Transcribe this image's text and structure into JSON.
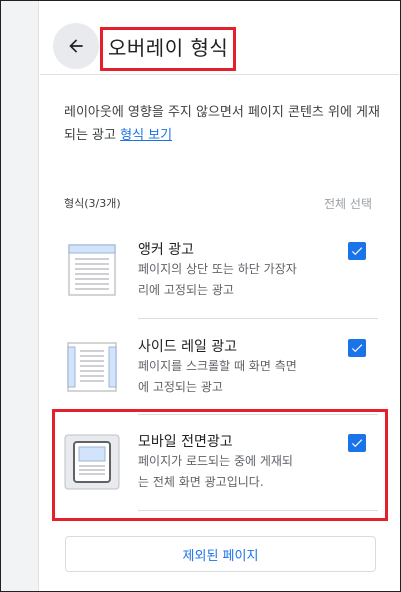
{
  "header": {
    "title": "오버레이 형식",
    "back_icon": "arrow-back-icon"
  },
  "description": {
    "text": "레이아웃에 영향을 주지 않으면서 페이지 콘텐츠 위에 게재되는 광고 ",
    "link": "형식 보기"
  },
  "list": {
    "count_label": "형식(3/3개)",
    "select_all_label": "전체 선택",
    "items": [
      {
        "name": "앵커 광고",
        "desc_line1": "페이지의 상단 또는 하단 가장자",
        "desc_line2": "리에 고정되는 광고",
        "checked": true
      },
      {
        "name": "사이드 레일 광고",
        "desc_line1": "페이지를 스크롤할 때 화면 측면",
        "desc_line2": "에 고정되는 광고",
        "checked": true
      },
      {
        "name": "모바일 전면광고",
        "desc_line1": "페이지가 로드되는 중에 게재되",
        "desc_line2": "는 전체 화면 광고입니다.",
        "checked": true
      }
    ]
  },
  "footer": {
    "excluded_pages_label": "제외된 페이지"
  },
  "colors": {
    "accent": "#1a73e8",
    "highlight": "#e5202a"
  }
}
